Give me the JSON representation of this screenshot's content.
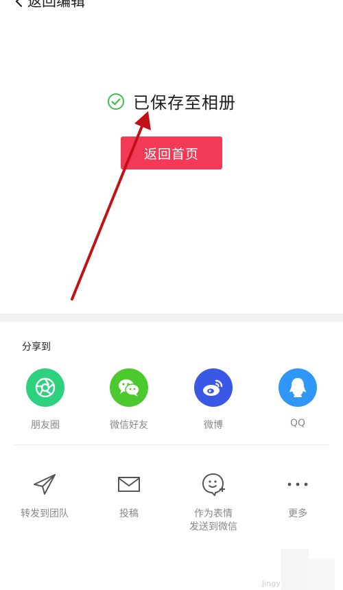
{
  "header": {
    "back_label": "返回编辑"
  },
  "status": {
    "saved_text": "已保存至相册"
  },
  "home_button": {
    "label": "返回首页"
  },
  "share": {
    "title": "分享到",
    "targets": [
      {
        "label": "朋友圈",
        "icon": "moments-icon",
        "color": "#2ed17e"
      },
      {
        "label": "微信好友",
        "icon": "wechat-icon",
        "color": "#4cc92c"
      },
      {
        "label": "微博",
        "icon": "weibo-icon",
        "color": "#3a58e6"
      },
      {
        "label": "QQ",
        "icon": "qq-icon",
        "color": "#2e97f7"
      }
    ]
  },
  "actions": [
    {
      "label": "转发到团队",
      "icon": "paper-plane-icon"
    },
    {
      "label": "投稿",
      "icon": "envelope-icon"
    },
    {
      "label_line1": "作为表情",
      "label_line2": "发送到微信",
      "icon": "sticker-add-icon"
    },
    {
      "label": "更多",
      "icon": "more-dots-icon"
    }
  ],
  "watermark": {
    "text": "Jingy"
  },
  "colors": {
    "accent": "#f23a57",
    "check_green": "#3fbf49",
    "arrow_red": "#c31017"
  }
}
